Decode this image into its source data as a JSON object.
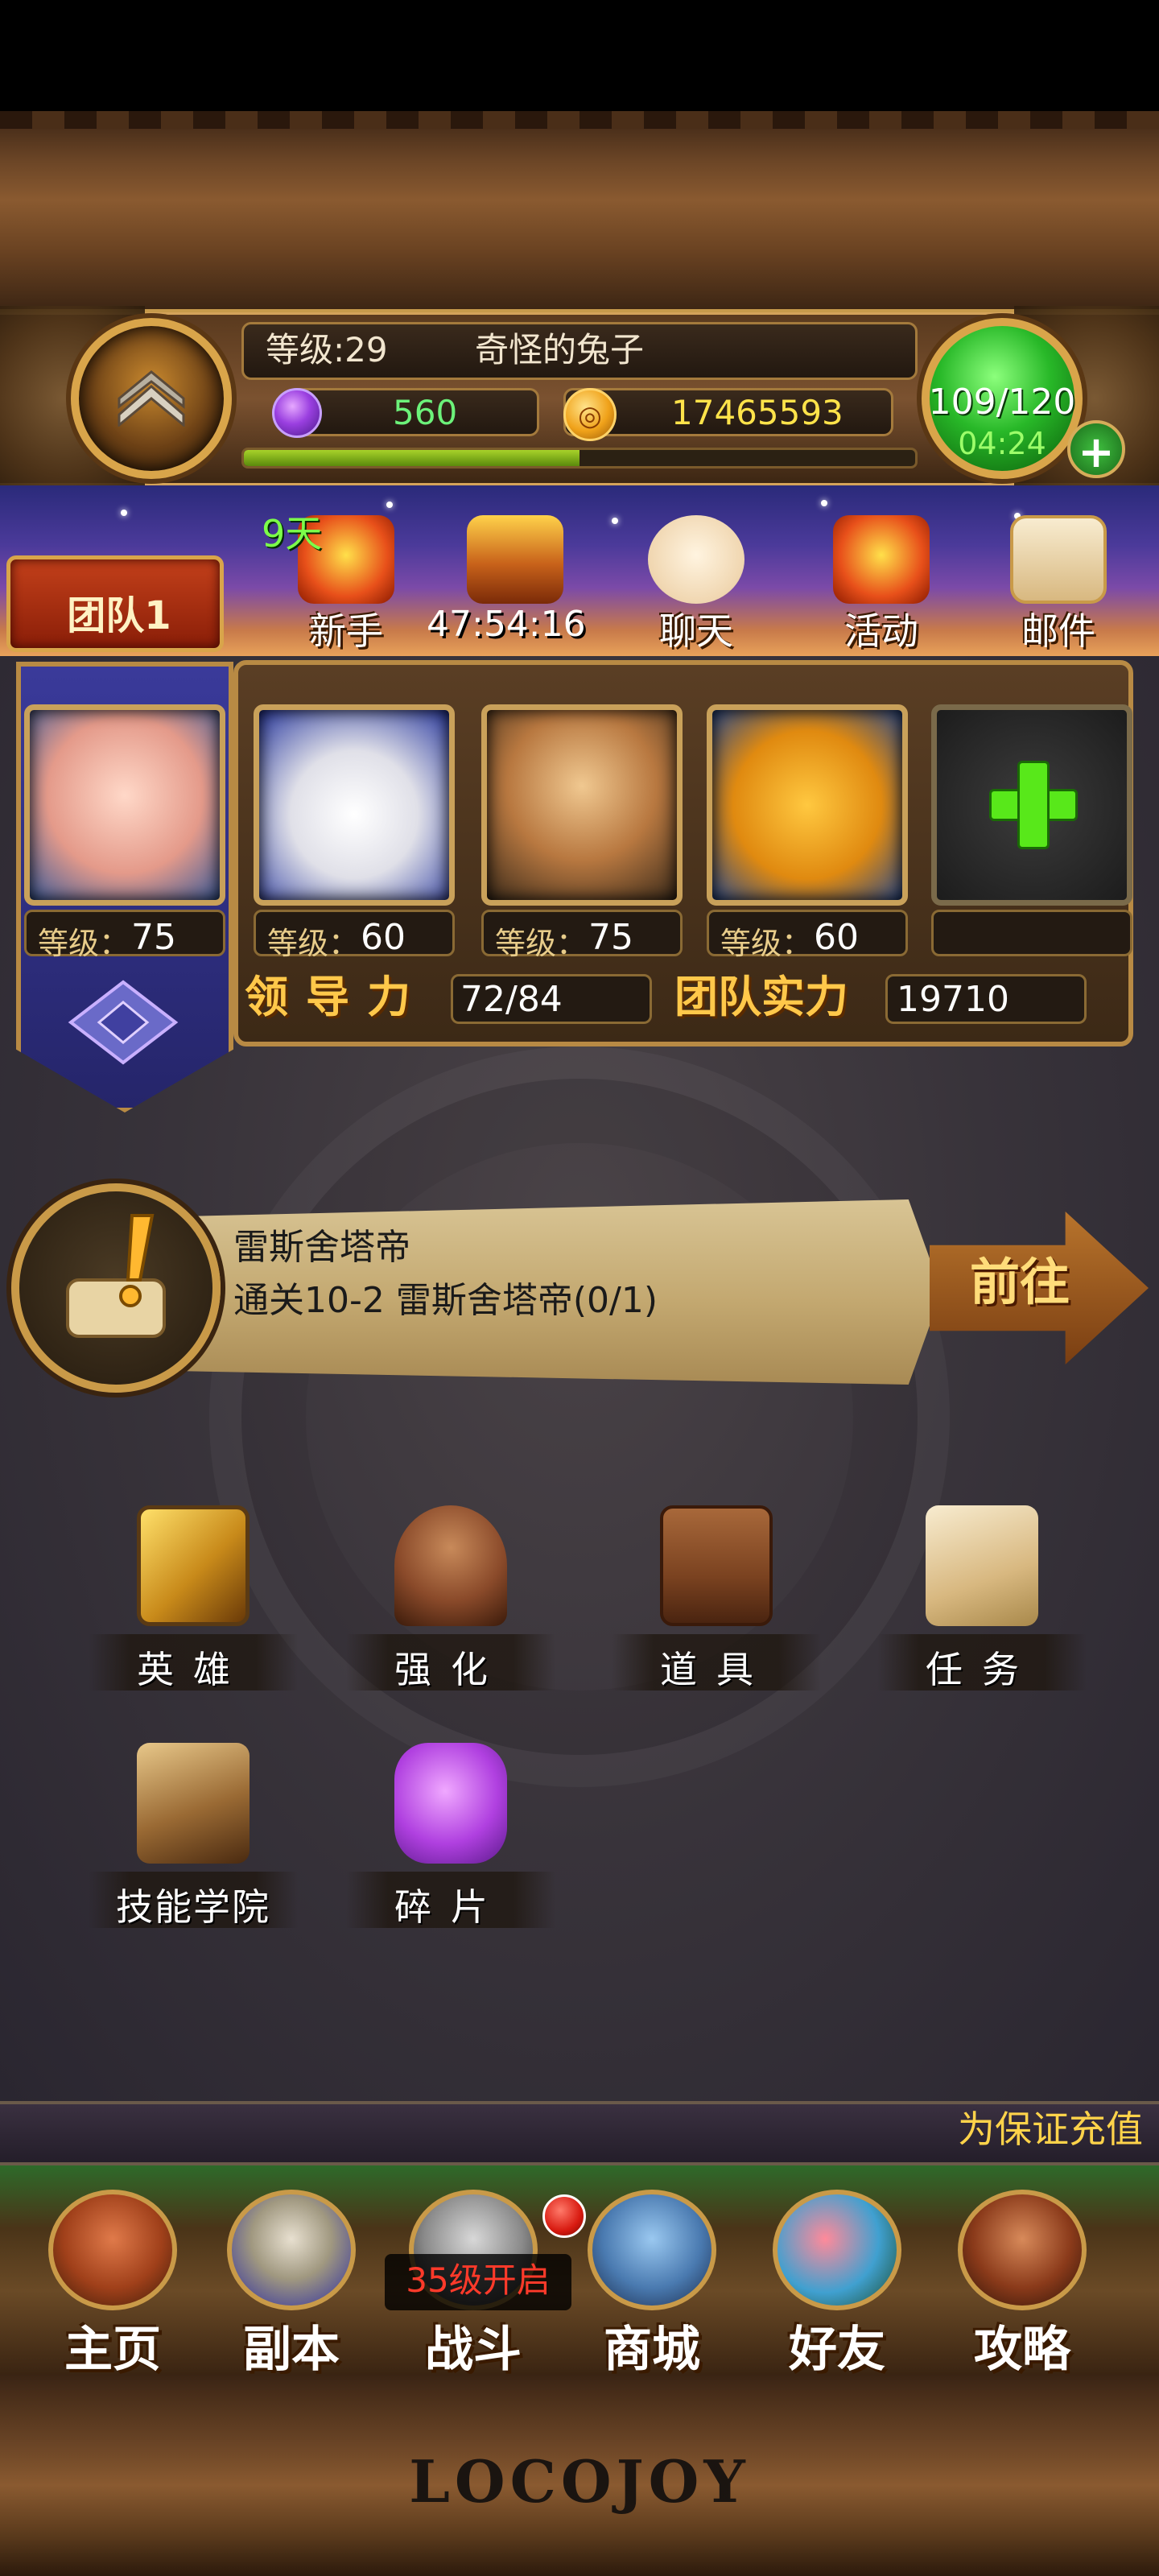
{
  "header": {
    "level_text": "等级:29",
    "player_name": "奇怪的兔子",
    "gems": "560",
    "gold": "17465593",
    "exp_fraction": 0.5,
    "stamina": "109/120",
    "stamina_timer": "04:24",
    "add_symbol": "+"
  },
  "menu": {
    "team_label": "团队1",
    "newbie_days": "9天",
    "chest_timer": "47:54:16",
    "items": [
      {
        "label": "新手",
        "icon": "gift-box-icon"
      },
      {
        "label": "",
        "icon": "treasure-chest-icon"
      },
      {
        "label": "聊天",
        "icon": "chat-bubble-icon"
      },
      {
        "label": "活动",
        "icon": "gift-box-icon"
      },
      {
        "label": "邮件",
        "icon": "mail-scroll-icon"
      }
    ]
  },
  "team": {
    "level_prefix": "等级：",
    "heroes": [
      {
        "level": "75",
        "icon": "pig-hero-portrait"
      },
      {
        "level": "60",
        "icon": "ghost-hero-portrait"
      },
      {
        "level": "75",
        "icon": "monk-hero-portrait"
      },
      {
        "level": "60",
        "icon": "frog-hero-portrait"
      }
    ],
    "leadership_label": "领导力",
    "leadership_value": "72/84",
    "power_label": "团队实力",
    "power_value": "19710"
  },
  "quest": {
    "title": "雷斯舍塔帝",
    "description": "通关10-2 雷斯舍塔帝(0/1)",
    "go_label": "前往"
  },
  "functions": [
    {
      "label": "英雄",
      "icon": "hero-card-icon"
    },
    {
      "label": "强化",
      "icon": "anvil-icon"
    },
    {
      "label": "道具",
      "icon": "backpack-icon"
    },
    {
      "label": "任务",
      "icon": "quest-scroll-icon"
    },
    {
      "label": "技能学院",
      "icon": "skill-book-icon"
    },
    {
      "label": "碎片",
      "icon": "puzzle-piece-icon"
    }
  ],
  "marquee": "为保证充值",
  "nav": [
    {
      "label": "主页",
      "icon": "house-icon"
    },
    {
      "label": "副本",
      "icon": "skull-icon"
    },
    {
      "label": "战斗",
      "icon": "sword-icon"
    },
    {
      "label": "商城",
      "icon": "monster-shop-icon"
    },
    {
      "label": "好友",
      "icon": "friends-icon"
    },
    {
      "label": "攻略",
      "icon": "guide-book-icon"
    }
  ],
  "battle_lock": "35级开启",
  "brand": "LOCOJOY",
  "colors": {
    "gold_text": "#ffe34a",
    "gem_text": "#6cf27a",
    "stamina_green": "#28b828",
    "label_gold": "#ffc84a",
    "lock_red": "#ff3a2a"
  }
}
